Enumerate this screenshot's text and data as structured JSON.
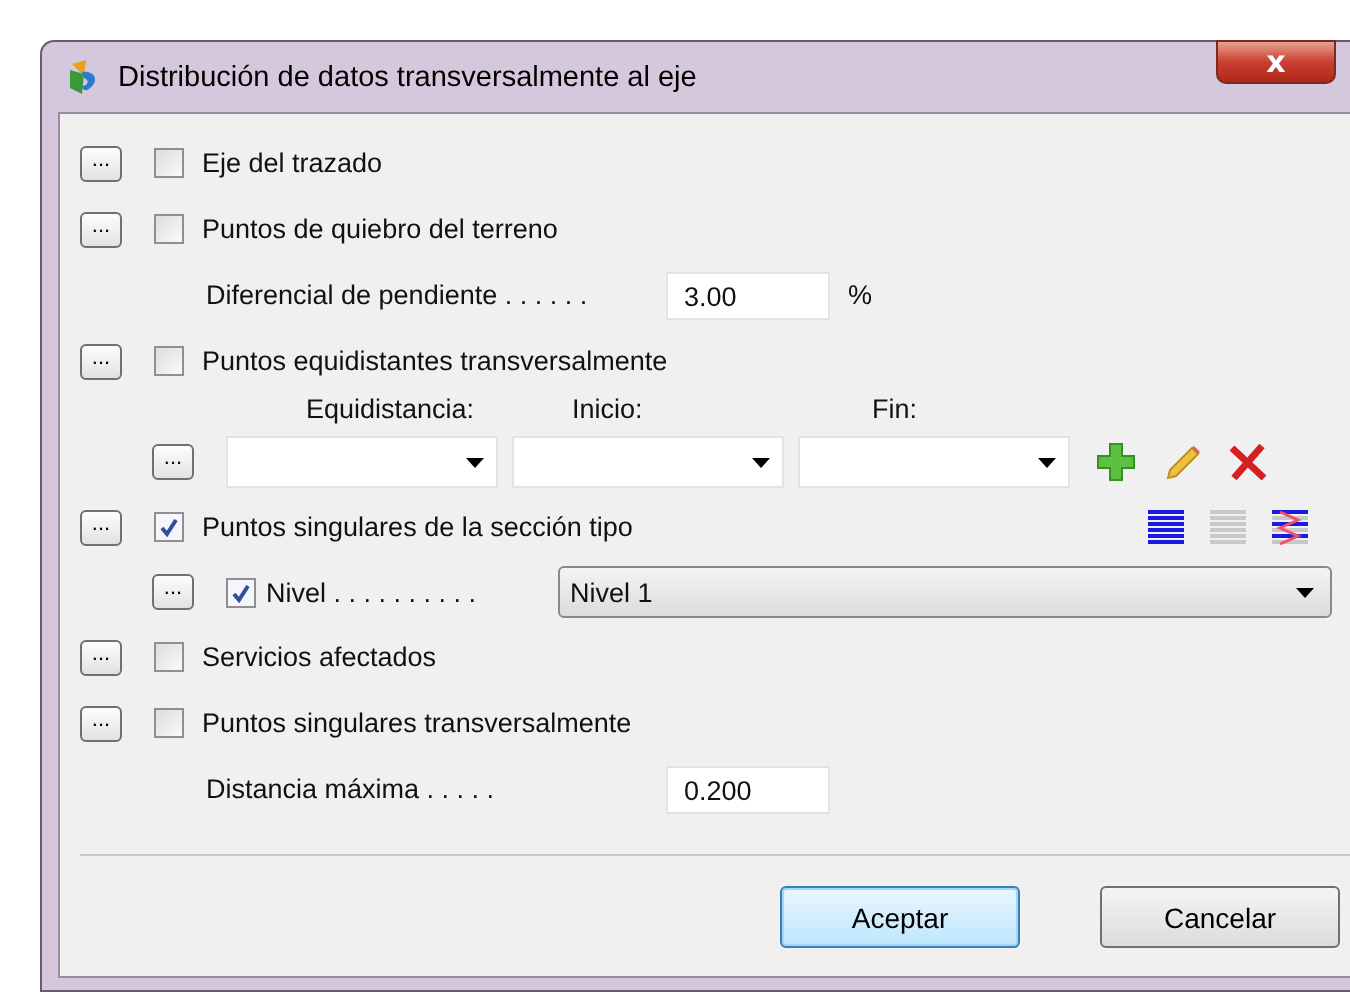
{
  "window": {
    "title": "Distribución de datos transversalmente al eje",
    "close": "x"
  },
  "rows": [
    {
      "kind": "check",
      "more": "...",
      "checked": false,
      "label": "Eje del trazado"
    },
    {
      "kind": "check",
      "more": "...",
      "checked": false,
      "label": "Puntos de quiebro del terreno"
    },
    {
      "kind": "value",
      "label": "Diferencial de pendiente . . . . . .",
      "value": "3.00",
      "unit": "%"
    },
    {
      "kind": "check",
      "more": "...",
      "checked": false,
      "label": "Puntos equidistantes transversalmente"
    },
    {
      "kind": "columns",
      "more": "...",
      "headers": [
        "Equidistancia:",
        "Inicio:",
        "Fin:"
      ]
    },
    {
      "kind": "check",
      "more": "...",
      "checked": true,
      "label": "Puntos singulares de la sección tipo",
      "tools": true
    },
    {
      "kind": "sub",
      "more": "...",
      "checked": true,
      "label": "Nivel . . . . . . . . . .",
      "value": "Nivel 1"
    },
    {
      "kind": "check",
      "more": "...",
      "checked": false,
      "label": "Servicios afectados"
    },
    {
      "kind": "check",
      "more": "...",
      "checked": false,
      "label": "Puntos singulares transversalmente"
    },
    {
      "kind": "value",
      "label": "Distancia máxima . . . . .",
      "value": "0.200"
    }
  ],
  "buttons": [
    {
      "label": "Aceptar",
      "default": true
    },
    {
      "label": "Cancelar",
      "default": false
    }
  ]
}
